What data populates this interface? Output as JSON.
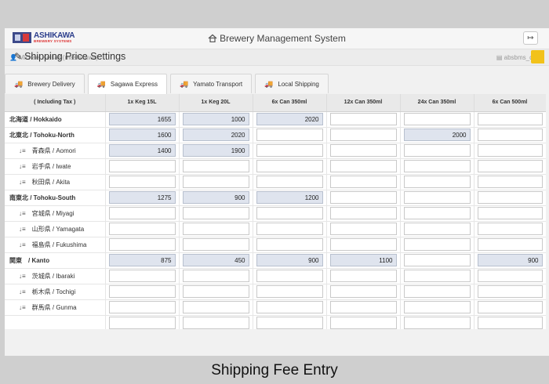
{
  "app": {
    "logo_name": "ASHIKAWA",
    "logo_sub": "BREWERY SYSTEMS",
    "title": "Brewery Management System",
    "logout_icon": "logout-icon"
  },
  "user_bar": {
    "user": "Michael Kelsall (mashikawa)",
    "database": "absbms_dev"
  },
  "page": {
    "title": "Shipping Price Settings"
  },
  "tabs": [
    {
      "label": "Brewery Delivery",
      "active": false
    },
    {
      "label": "Sagawa Express",
      "active": true
    },
    {
      "label": "Yamato Transport",
      "active": false
    },
    {
      "label": "Local Shipping",
      "active": false
    }
  ],
  "table": {
    "headers": [
      "( Including Tax )",
      "1x Keg 15L",
      "1x Keg 20L",
      "6x Can 350ml",
      "12x Can 350ml",
      "24x Can 350ml",
      "6x Can 500ml"
    ],
    "rows": [
      {
        "name": "北海道 / Hokkaido",
        "region": true,
        "values": [
          "1655",
          "1000",
          "2020",
          "",
          "",
          ""
        ]
      },
      {
        "name": "北東北 / Tohoku-North",
        "region": true,
        "values": [
          "1600",
          "2020",
          "",
          "",
          "2000",
          ""
        ]
      },
      {
        "name": "青森県 / Aomori",
        "region": false,
        "values": [
          "1400",
          "1900",
          "",
          "",
          "",
          ""
        ]
      },
      {
        "name": "岩手県 / Iwate",
        "region": false,
        "values": [
          "",
          "",
          "",
          "",
          "",
          ""
        ]
      },
      {
        "name": "秋田県 / Akita",
        "region": false,
        "values": [
          "",
          "",
          "",
          "",
          "",
          ""
        ]
      },
      {
        "name": "南東北 / Tohoku-South",
        "region": true,
        "values": [
          "1275",
          "900",
          "1200",
          "",
          "",
          ""
        ]
      },
      {
        "name": "宮城県 / Miyagi",
        "region": false,
        "values": [
          "",
          "",
          "",
          "",
          "",
          ""
        ]
      },
      {
        "name": "山形県 / Yamagata",
        "region": false,
        "values": [
          "",
          "",
          "",
          "",
          "",
          ""
        ]
      },
      {
        "name": "福島県 / Fukushima",
        "region": false,
        "values": [
          "",
          "",
          "",
          "",
          "",
          ""
        ]
      },
      {
        "name": "関東　/ Kanto",
        "region": true,
        "values": [
          "875",
          "450",
          "900",
          "1100",
          "",
          "900"
        ]
      },
      {
        "name": "茨城県 / Ibaraki",
        "region": false,
        "values": [
          "",
          "",
          "",
          "",
          "",
          ""
        ]
      },
      {
        "name": "栃木県 / Tochigi",
        "region": false,
        "values": [
          "",
          "",
          "",
          "",
          "",
          ""
        ]
      },
      {
        "name": "群馬県 / Gunma",
        "region": false,
        "values": [
          "",
          "",
          "",
          "",
          "",
          ""
        ]
      },
      {
        "name": "",
        "region": false,
        "values": [
          "",
          "",
          "",
          "",
          "",
          ""
        ]
      }
    ]
  },
  "caption": "Shipping Fee Entry"
}
